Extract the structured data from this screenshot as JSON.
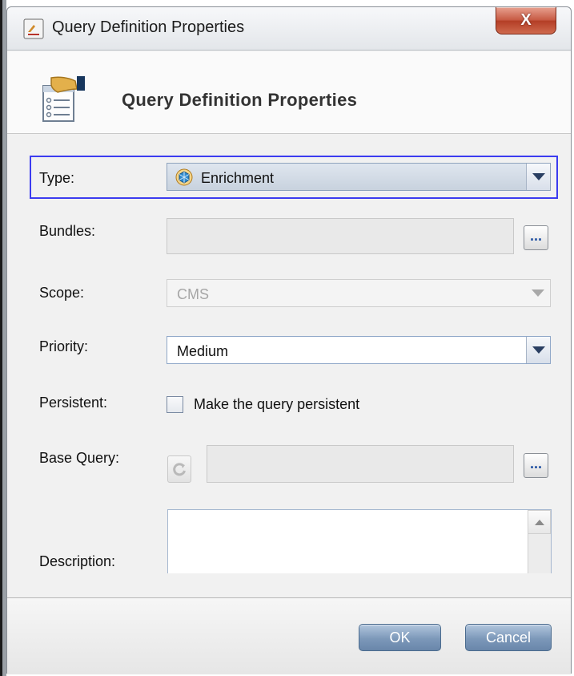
{
  "window": {
    "title": "Query Definition Properties",
    "close_label": "X"
  },
  "header": {
    "title": "Query Definition Properties",
    "icon": "query-properties-icon"
  },
  "form": {
    "type": {
      "label": "Type:",
      "value": "Enrichment",
      "icon": "enrichment-icon"
    },
    "bundles": {
      "label": "Bundles:",
      "value": "",
      "button_label": "..."
    },
    "scope": {
      "label": "Scope:",
      "value": "CMS",
      "disabled": true
    },
    "priority": {
      "label": "Priority:",
      "value": "Medium"
    },
    "persistent": {
      "label": "Persistent:",
      "checkbox_label": "Make the query persistent",
      "checked": false
    },
    "base_query": {
      "label": "Base Query:",
      "value": "",
      "button_label": "..."
    },
    "description": {
      "label": "Description:",
      "value": ""
    }
  },
  "footer": {
    "ok_label": "OK",
    "cancel_label": "Cancel"
  },
  "colors": {
    "focus_border": "#3c3cf0",
    "button_blue": "#7c98b9",
    "close_red": "#c65841"
  }
}
